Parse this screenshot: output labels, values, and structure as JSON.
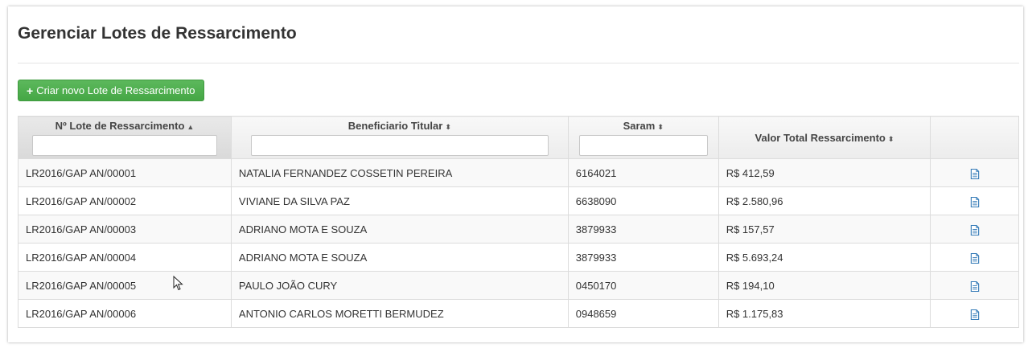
{
  "page": {
    "title": "Gerenciar Lotes de Ressarcimento",
    "create_button_label": "Criar novo Lote de Ressarcimento"
  },
  "table": {
    "columns": [
      {
        "label": "Nº Lote de Ressarcimento",
        "sort": "ascending",
        "filter": true
      },
      {
        "label": "Beneficiario Titular",
        "sort": "none",
        "filter": true
      },
      {
        "label": "Saram",
        "sort": "none",
        "filter": true
      },
      {
        "label": "Valor Total Ressarcimento",
        "sort": "none",
        "filter": false
      },
      {
        "label": "",
        "sort": "none",
        "filter": false
      }
    ],
    "rows": [
      {
        "lote": "LR2016/GAP AN/00001",
        "beneficiario": "NATALIA FERNANDEZ COSSETIN PEREIRA",
        "saram": "6164021",
        "valor": "R$ 412,59"
      },
      {
        "lote": "LR2016/GAP AN/00002",
        "beneficiario": "VIVIANE DA SILVA PAZ",
        "saram": "6638090",
        "valor": "R$ 2.580,96"
      },
      {
        "lote": "LR2016/GAP AN/00003",
        "beneficiario": "ADRIANO MOTA E SOUZA",
        "saram": "3879933",
        "valor": "R$ 157,57"
      },
      {
        "lote": "LR2016/GAP AN/00004",
        "beneficiario": "ADRIANO MOTA E SOUZA",
        "saram": "3879933",
        "valor": "R$ 5.693,24"
      },
      {
        "lote": "LR2016/GAP AN/00005",
        "beneficiario": "PAULO JOÃO CURY",
        "saram": "0450170",
        "valor": "R$ 194,10"
      },
      {
        "lote": "LR2016/GAP AN/00006",
        "beneficiario": "ANTONIO CARLOS MORETTI BERMUDEZ",
        "saram": "0948659",
        "valor": "R$ 1.175,83"
      }
    ]
  },
  "icons": {
    "create": "plus-icon",
    "sort_asc": "sort-asc-icon",
    "sort_both": "sort-both-icon",
    "row_action": "document-icon",
    "pointer": "mouse-cursor-icon"
  },
  "colors": {
    "button_green": "#5cb85c",
    "icon_blue": "#337ab7"
  }
}
